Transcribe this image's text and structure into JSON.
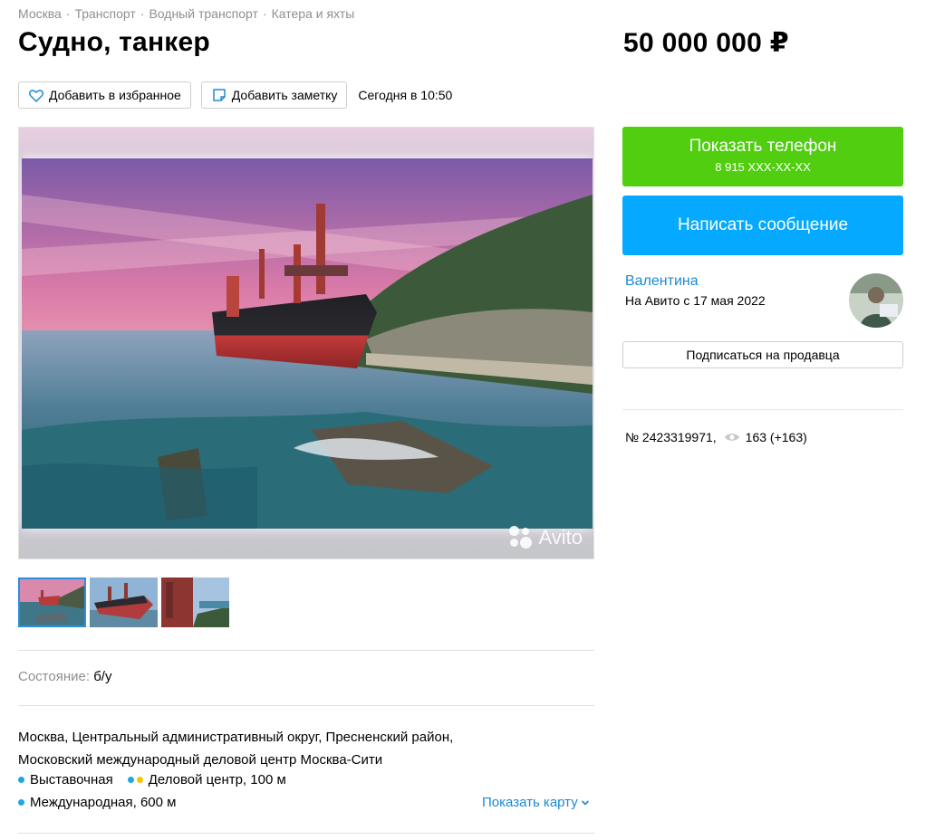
{
  "breadcrumb": [
    "Москва",
    "Транспорт",
    "Водный транспорт",
    "Катера и яхты"
  ],
  "title": "Судно, танкер",
  "price": "50 000 000 ₽",
  "actions": {
    "favorite_label": "Добавить в избранное",
    "note_label": "Добавить заметку",
    "posted": "Сегодня в 10:50"
  },
  "gallery": {
    "watermark": "Avito",
    "thumb_count": 3
  },
  "params": {
    "condition_label": "Состояние:",
    "condition_value": "б/у"
  },
  "location": {
    "address": "Москва, Центральный административный округ, Пресненский район, Московский международный деловой центр Москва-Сити",
    "metro": [
      {
        "name": "Выставочная",
        "colors": [
          "#1fa7e0"
        ]
      },
      {
        "name": "Деловой центр, 100 м",
        "colors": [
          "#1fa7e0",
          "#f6c700"
        ]
      },
      {
        "name": "Международная, 600 м",
        "colors": [
          "#1fa7e0"
        ]
      }
    ],
    "show_map": "Показать карту"
  },
  "contact": {
    "phone_label": "Показать телефон",
    "phone_masked": "8 915 XXX-XX-XX",
    "message_label": "Написать сообщение"
  },
  "seller": {
    "name": "Валентина",
    "since": "На Авито с 17 мая 2022",
    "subscribe_label": "Подписаться на продавца"
  },
  "item": {
    "number": "№ 2423319971,",
    "views": "163 (+163)"
  },
  "colors": {
    "green": "#50ce0f",
    "blue": "#05a9ff",
    "link": "#1b8ad6",
    "muted": "#8f8f8f"
  }
}
